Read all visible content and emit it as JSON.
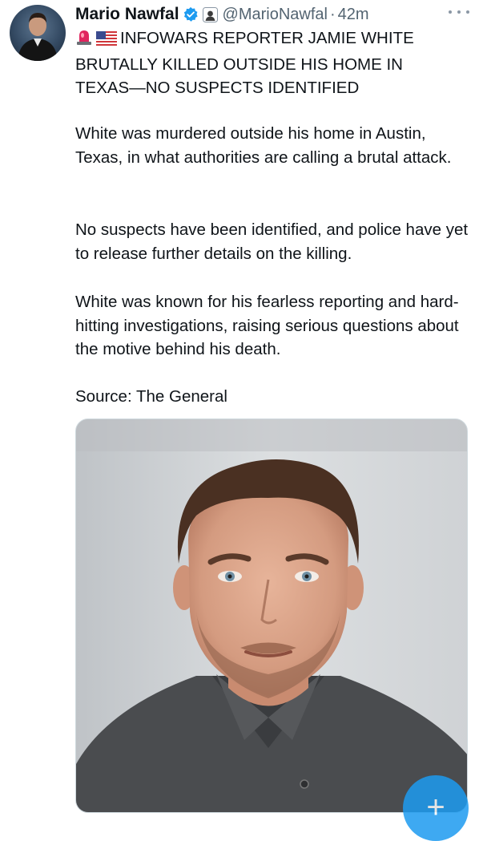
{
  "author": {
    "name": "Mario Nawfal",
    "handle": "@MarioNawfal",
    "separator": "·",
    "time": "42m",
    "verified_badge_color": "#1d9bf0",
    "icons": [
      "verified-badge-icon",
      "affiliate-badge-icon"
    ]
  },
  "tweet": {
    "headline_lines": [
      "INFOWARS REPORTER JAMIE WHITE",
      "BRUTALLY KILLED OUTSIDE HIS HOME IN",
      "TEXAS—NO SUSPECTS IDENTIFIED"
    ],
    "headline_emoji": [
      "rotating-light-icon",
      "us-flag-icon"
    ],
    "paragraphs": [
      "White was murdered outside his home in Austin, Texas, in what authorities are calling a brutal attack.",
      "No suspects have been identified, and police have yet to release further details on the killing.",
      "White was known for his fearless reporting and hard-hitting investigations, raising serious questions about the motive behind his death.",
      "Source: The General"
    ]
  },
  "media": {
    "kind": "photo",
    "subject": "portrait"
  },
  "compose_button": {
    "label": "+",
    "color": "#1d9bf0"
  },
  "colors": {
    "text": "#0f1419",
    "secondary": "#536471",
    "accent": "#1d9bf0"
  }
}
